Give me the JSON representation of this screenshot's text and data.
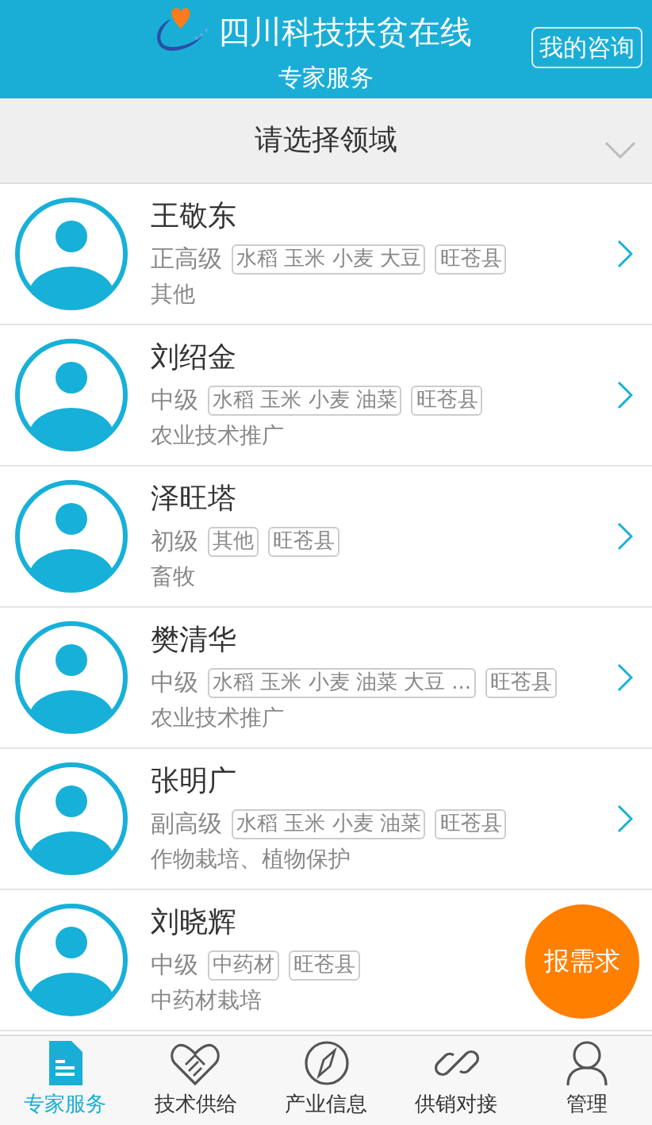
{
  "header": {
    "title": "四川科技扶贫在线",
    "subtitle": "专家服务",
    "action": "我的咨询"
  },
  "filter": {
    "label": "请选择领域"
  },
  "experts": [
    {
      "name": "王敬东",
      "level": "正高级",
      "tags": [
        "水稻 玉米 小麦 大豆",
        "旺苍县"
      ],
      "field": "其他",
      "chevron": true
    },
    {
      "name": "刘绍金",
      "level": "中级",
      "tags": [
        "水稻 玉米 小麦 油菜",
        "旺苍县"
      ],
      "field": "农业技术推广",
      "chevron": true
    },
    {
      "name": "泽旺塔",
      "level": "初级",
      "tags": [
        "其他",
        "旺苍县"
      ],
      "field": "畜牧",
      "chevron": true
    },
    {
      "name": "樊清华",
      "level": "中级",
      "tags": [
        "水稻 玉米 小麦 油菜 大豆 ...",
        "旺苍县"
      ],
      "field": "农业技术推广",
      "chevron": true
    },
    {
      "name": "张明广",
      "level": "副高级",
      "tags": [
        "水稻 玉米 小麦 油菜",
        "旺苍县"
      ],
      "field": "作物栽培、植物保护",
      "chevron": true
    },
    {
      "name": "刘晓辉",
      "level": "中级",
      "tags": [
        "中药材",
        "旺苍县"
      ],
      "field": "中药材栽培",
      "chevron": false
    }
  ],
  "fab": {
    "label": "报需求"
  },
  "tabs": [
    {
      "label": "专家服务",
      "kind": "document",
      "selected": true
    },
    {
      "label": "技术供给",
      "kind": "handshake",
      "selected": false
    },
    {
      "label": "产业信息",
      "kind": "compass",
      "selected": false
    },
    {
      "label": "供销对接",
      "kind": "link",
      "selected": false
    },
    {
      "label": "管理",
      "kind": "person",
      "selected": false
    }
  ]
}
